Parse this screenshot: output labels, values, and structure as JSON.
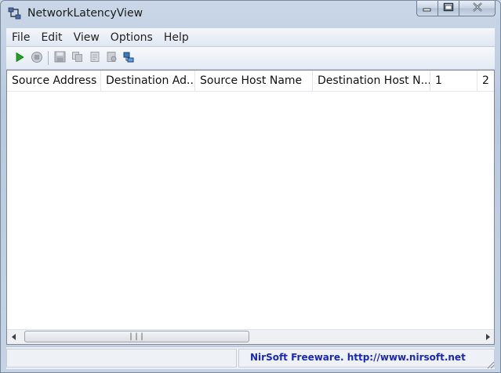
{
  "window": {
    "title": "NetworkLatencyView",
    "app_icon": "network-icon",
    "controls": {
      "minimize": "minimize-icon",
      "maximize": "maximize-icon",
      "close": "close-icon"
    }
  },
  "menu": [
    {
      "label": "File"
    },
    {
      "label": "Edit"
    },
    {
      "label": "View"
    },
    {
      "label": "Options"
    },
    {
      "label": "Help"
    }
  ],
  "toolbar": {
    "buttons": [
      {
        "icon": "play-icon",
        "enabled": true
      },
      {
        "icon": "stop-icon",
        "enabled": false
      },
      {
        "icon": "save-icon",
        "enabled": false
      },
      {
        "icon": "copy-icon",
        "enabled": false
      },
      {
        "icon": "html-report-icon",
        "enabled": false
      },
      {
        "icon": "properties-icon",
        "enabled": false
      },
      {
        "icon": "refresh-icon",
        "enabled": true
      }
    ]
  },
  "table": {
    "columns": [
      {
        "label": "Source Address"
      },
      {
        "label": "Destination Ad..."
      },
      {
        "label": "Source Host Name"
      },
      {
        "label": "Destination Host N..."
      },
      {
        "label": "1"
      },
      {
        "label": "2"
      }
    ],
    "rows": []
  },
  "statusbar": {
    "panel1_text": "",
    "link_text": "NirSoft Freeware.  http://www.nirsoft.net"
  },
  "colors": {
    "link": "#1a28b8",
    "play": "#1fa31f"
  }
}
